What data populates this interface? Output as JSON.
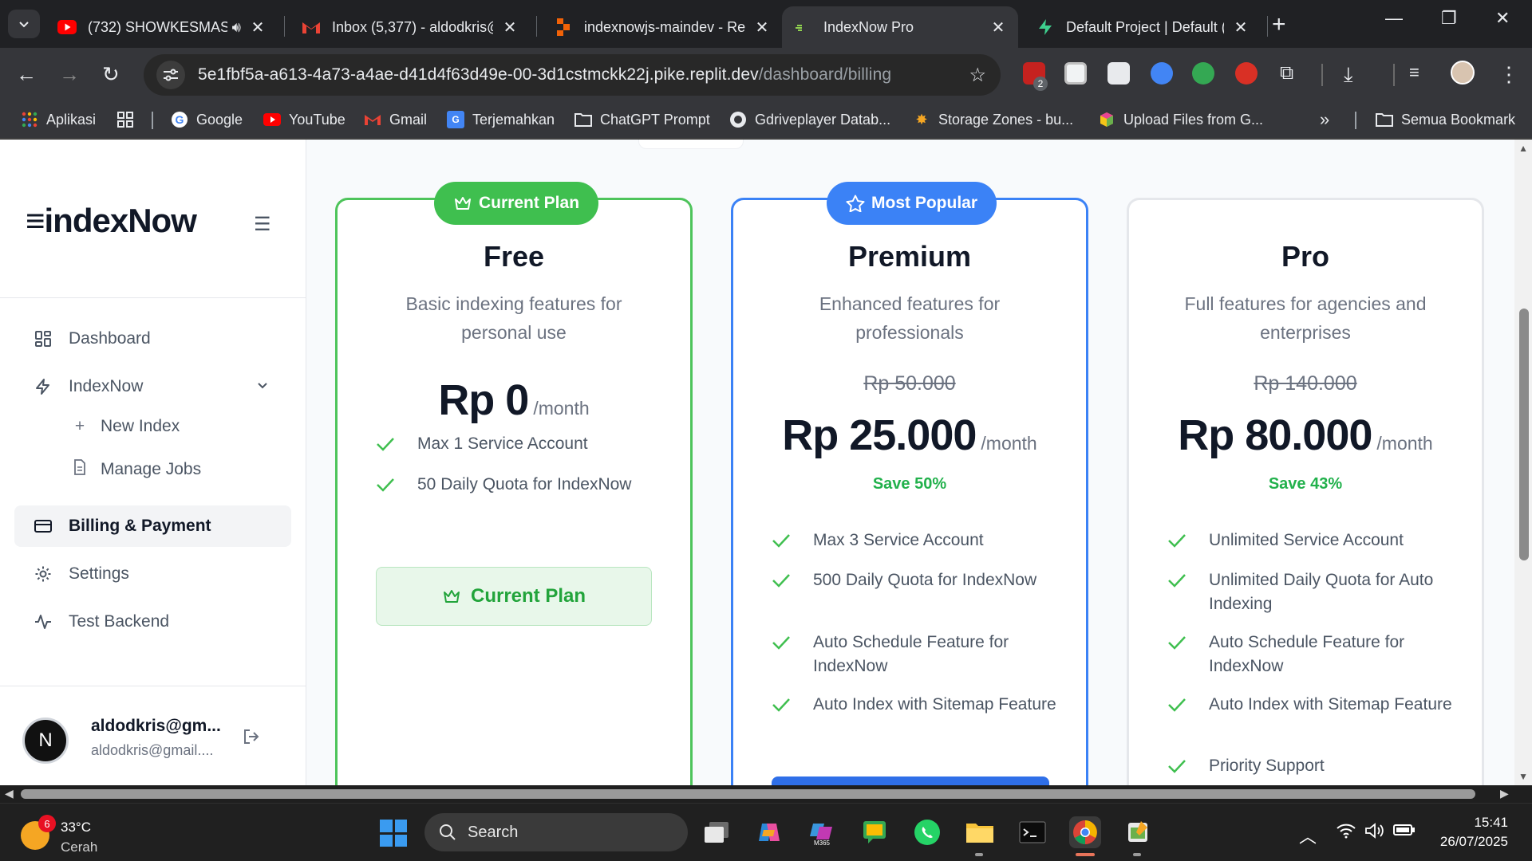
{
  "browser": {
    "tabs": [
      {
        "title": "(732) SHOWKESMAS",
        "favicon": "youtube-icon",
        "audio": true,
        "active": false
      },
      {
        "title": "Inbox (5,377) - aldodkris@",
        "favicon": "gmail-icon",
        "active": false
      },
      {
        "title": "indexnowjs-maindev - Re",
        "favicon": "replit-icon",
        "active": false
      },
      {
        "title": "IndexNow Pro",
        "favicon": "indexnow-icon",
        "active": true
      },
      {
        "title": "Default Project | Default (",
        "favicon": "supabase-icon",
        "active": false
      }
    ],
    "url_host": "5e1fbf5a-a613-4a73-a4ae-d41d4f63d49e-00-3d1cstmckk22j.pike.replit.dev",
    "url_path": "/dashboard/billing",
    "extension_badge": "2",
    "bookmarks": [
      {
        "label": "Aplikasi",
        "icon": "apps-grid-icon"
      },
      {
        "label": "Google",
        "icon": "google-icon"
      },
      {
        "label": "YouTube",
        "icon": "youtube-icon"
      },
      {
        "label": "Gmail",
        "icon": "gmail-icon"
      },
      {
        "label": "Terjemahkan",
        "icon": "translate-icon"
      },
      {
        "label": "ChatGPT Prompt",
        "icon": "folder-icon"
      },
      {
        "label": "Gdriveplayer Datab...",
        "icon": "globe-icon"
      },
      {
        "label": "Storage Zones - bu...",
        "icon": "bunny-icon"
      },
      {
        "label": "Upload Files from G...",
        "icon": "box-icon"
      }
    ],
    "all_bookmarks": "Semua Bookmark"
  },
  "app": {
    "logo": "≡indexNow",
    "nav": {
      "dashboard": "Dashboard",
      "indexnow": "IndexNow",
      "new_index": "New Index",
      "manage_jobs": "Manage Jobs",
      "billing": "Billing & Payment",
      "settings": "Settings",
      "test_backend": "Test Backend"
    },
    "user": {
      "initial": "N",
      "name": "aldodkris@gm...",
      "email": "aldodkris@gmail...."
    }
  },
  "plans": [
    {
      "badge": "Current Plan",
      "name": "Free",
      "description": "Basic indexing features for personal use",
      "price": "Rp 0",
      "period": "/month",
      "features": [
        "Max 1 Service Account",
        "50 Daily Quota for IndexNow"
      ],
      "button": "Current Plan"
    },
    {
      "badge": "Most Popular",
      "name": "Premium",
      "description": "Enhanced features for professionals",
      "old_price": "Rp 50.000",
      "price": "Rp 25.000",
      "period": "/month",
      "save": "Save 50%",
      "features": [
        "Max 3 Service Account",
        "500 Daily Quota for IndexNow",
        "Auto Schedule Feature for IndexNow",
        "Auto Index with Sitemap Feature"
      ]
    },
    {
      "name": "Pro",
      "description": "Full features for agencies and enterprises",
      "old_price": "Rp 140.000",
      "price": "Rp 80.000",
      "period": "/month",
      "save": "Save 43%",
      "features": [
        "Unlimited Service Account",
        "Unlimited Daily Quota for Auto Indexing",
        "Auto Schedule Feature for IndexNow",
        "Auto Index with Sitemap Feature",
        "Priority Support"
      ]
    }
  ],
  "taskbar": {
    "weather_badge": "6",
    "temperature": "33°C",
    "condition": "Cerah",
    "search": "Search",
    "time": "15:41",
    "date": "26/07/2025"
  },
  "colors": {
    "accent_green": "#3fbf4f",
    "accent_blue": "#3b82f6",
    "save_green": "#22b14c"
  }
}
